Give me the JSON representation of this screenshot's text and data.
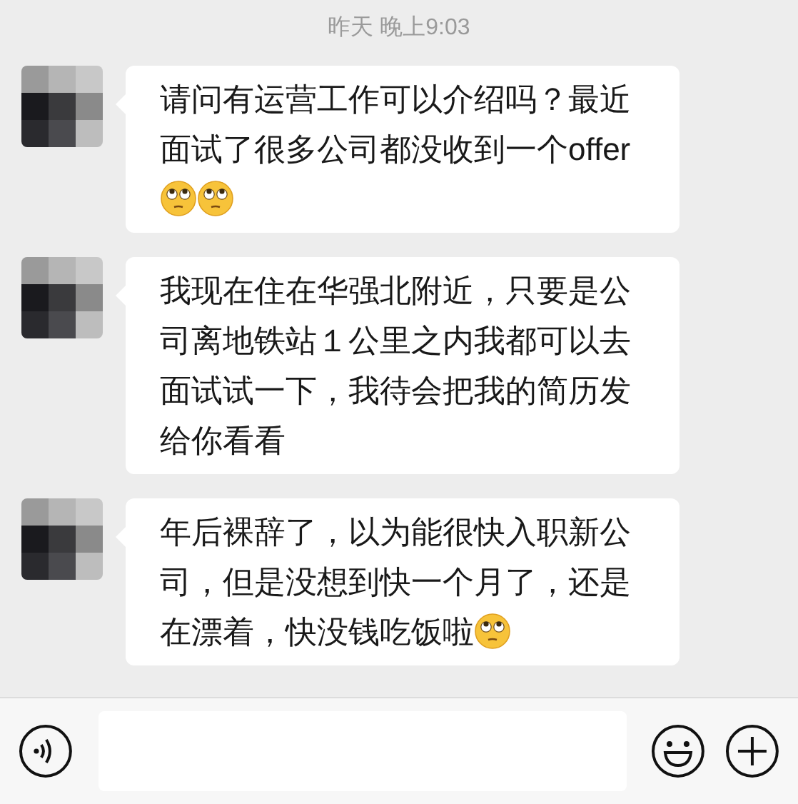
{
  "timestamp": "昨天 晚上9:03",
  "messages": [
    {
      "parts": [
        {
          "kind": "text",
          "text": "请问有运营工作可以介绍吗？最近面试了很多公司都没收到一个offer"
        },
        {
          "kind": "emoji"
        },
        {
          "kind": "emoji"
        }
      ]
    },
    {
      "parts": [
        {
          "kind": "text",
          "text": "我现在住在华强北附近，只要是公司离地铁站１公里之内我都可以去面试试一下，我待会把我的简历发给你看看"
        }
      ]
    },
    {
      "parts": [
        {
          "kind": "text",
          "text": "年后裸辞了，以为能很快入职新公司，但是没想到快一个月了，还是在漂着，快没钱吃饭啦"
        },
        {
          "kind": "emoji"
        }
      ]
    }
  ]
}
